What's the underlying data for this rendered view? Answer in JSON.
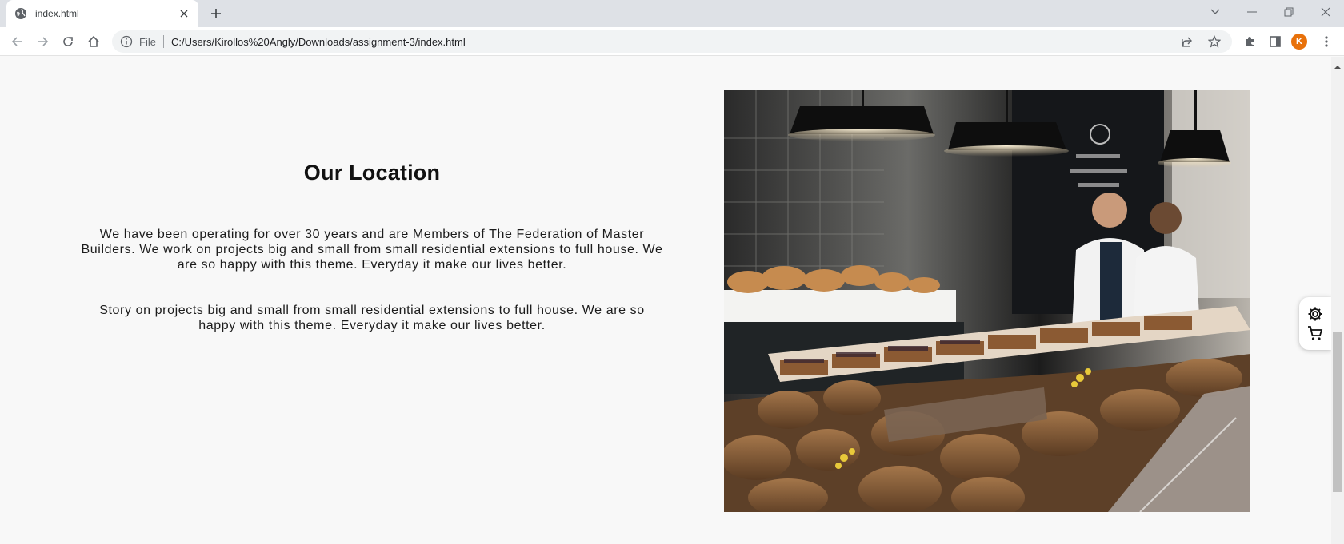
{
  "browser": {
    "tab": {
      "title": "index.html"
    },
    "address": {
      "scheme_label": "File",
      "url": "C:/Users/Kirollos%20Angly/Downloads/assignment-3/index.html"
    },
    "profile_initial": "K"
  },
  "page": {
    "location": {
      "title": "Our Location",
      "paragraph_1": "We have been operating for over 30 years and are Members of The Federation of Master Builders. We work on projects big and small from small residential extensions to full house. We are so happy with this theme. Everyday it make our lives better.",
      "paragraph_2": "Story on projects big and small from small residential extensions to full house. We are so happy with this theme. Everyday it make our lives better."
    },
    "image": {
      "alt": "bakery",
      "subject": "bakery counter with breads and pastries"
    }
  },
  "colors": {
    "page_bg": "#f8f8f8",
    "avatar": "#e8710a",
    "tabstrip": "#dee1e6"
  }
}
